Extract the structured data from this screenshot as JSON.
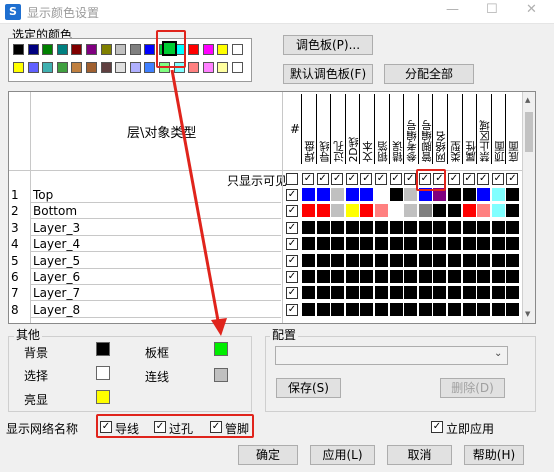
{
  "window": {
    "title": "显示颜色设置",
    "minimize": "—",
    "maximize": "☐",
    "close": "✕",
    "icon": "S"
  },
  "selected_color": {
    "label": "选定的颜色",
    "value": "#00cc33"
  },
  "palette": {
    "row1": [
      "#000000",
      "#000080",
      "#008000",
      "#008080",
      "#800000",
      "#800080",
      "#808000",
      "#c0c0c0",
      "#808080",
      "#0000ff",
      "#00cc33",
      "#00ffff",
      "#ff0000",
      "#ff00ff",
      "#ffff00",
      "#ffffff"
    ],
    "row2": [
      "#ffff00",
      "#6060ff",
      "#40b0b0",
      "#40a040",
      "#c08040",
      "#a06030",
      "#604040",
      "#e0e0e0",
      "#b0b0ff",
      "#4080ff",
      "#80ff80",
      "#80ffff",
      "#ff8080",
      "#ff80ff",
      "#ffffa0",
      "#ffffff"
    ]
  },
  "buttons": {
    "palette": "调色板(P)...",
    "default_palette": "默认调色板(F)",
    "assign_all": "分配全部",
    "save": "保存(S)",
    "delete": "删除(D)",
    "ok": "确定",
    "apply": "应用(L)",
    "cancel": "取消",
    "help": "帮助(H)"
  },
  "table": {
    "layer_header": "层\\对象类型",
    "hash_header": "#",
    "columns": [
      "焊盘",
      "导线",
      "过孔",
      "2D线",
      "文本",
      "铜箔",
      "错误",
      "参考编号",
      "管脚编号",
      "网络名",
      "类型",
      "属性",
      "禁止区域",
      "顶面",
      "底面"
    ],
    "visible_only_label": "只显示可见",
    "rows": [
      {
        "num": "1",
        "name": "Top"
      },
      {
        "num": "2",
        "name": "Bottom"
      },
      {
        "num": "3",
        "name": "Layer_3"
      },
      {
        "num": "4",
        "name": "Layer_4"
      },
      {
        "num": "5",
        "name": "Layer_5"
      },
      {
        "num": "6",
        "name": "Layer_6"
      },
      {
        "num": "7",
        "name": "Layer_7"
      },
      {
        "num": "8",
        "name": "Layer_8"
      }
    ],
    "cell_colors": [
      [
        "#0000ff",
        "#0000ff",
        "#c0c0c0",
        "#0000ff",
        "#0000ff",
        "#ffffff",
        "#000000",
        "#c0c0c0",
        "#0000ff",
        "#800080",
        "#000000",
        "#000000",
        "#0000ff",
        "#80ffff",
        "#000000"
      ],
      [
        "#ff0000",
        "#ff0000",
        "#c0c0c0",
        "#ffff00",
        "#ff0000",
        "#ff8080",
        "#ffffff",
        "#c0c0c0",
        "#808080",
        "#000000",
        "#000000",
        "#ff0000",
        "#ff8080",
        "#80ffff",
        "#000000"
      ],
      [
        "#000000",
        "#000000",
        "#000000",
        "#000000",
        "#000000",
        "#000000",
        "#000000",
        "#000000",
        "#000000",
        "#000000",
        "#000000",
        "#000000",
        "#000000",
        "#000000",
        "#000000"
      ],
      [
        "#000000",
        "#000000",
        "#000000",
        "#000000",
        "#000000",
        "#000000",
        "#000000",
        "#000000",
        "#000000",
        "#000000",
        "#000000",
        "#000000",
        "#000000",
        "#000000",
        "#000000"
      ],
      [
        "#000000",
        "#000000",
        "#000000",
        "#000000",
        "#000000",
        "#000000",
        "#000000",
        "#000000",
        "#000000",
        "#000000",
        "#000000",
        "#000000",
        "#000000",
        "#000000",
        "#000000"
      ],
      [
        "#000000",
        "#000000",
        "#000000",
        "#000000",
        "#000000",
        "#000000",
        "#000000",
        "#000000",
        "#000000",
        "#000000",
        "#000000",
        "#000000",
        "#000000",
        "#000000",
        "#000000"
      ],
      [
        "#000000",
        "#000000",
        "#000000",
        "#000000",
        "#000000",
        "#000000",
        "#000000",
        "#000000",
        "#000000",
        "#000000",
        "#000000",
        "#000000",
        "#000000",
        "#000000",
        "#000000"
      ],
      [
        "#000000",
        "#000000",
        "#000000",
        "#000000",
        "#000000",
        "#000000",
        "#000000",
        "#000000",
        "#000000",
        "#000000",
        "#000000",
        "#000000",
        "#000000",
        "#000000",
        "#000000"
      ]
    ]
  },
  "other": {
    "title": "其他",
    "items": [
      {
        "label": "背景",
        "color": "#000000"
      },
      {
        "label": "选择",
        "color": "#ffffff"
      },
      {
        "label": "亮显",
        "color": "#ffff00"
      },
      {
        "label": "板框",
        "color": "#00ee00"
      },
      {
        "label": "连线",
        "color": "#c0c0c0"
      }
    ]
  },
  "config": {
    "title": "配置",
    "value": ""
  },
  "net_names": {
    "label": "显示网络名称",
    "options": [
      {
        "label": "导线",
        "checked": true
      },
      {
        "label": "过孔",
        "checked": true
      },
      {
        "label": "管脚",
        "checked": true
      }
    ]
  },
  "apply_now": {
    "label": "立即应用",
    "checked": true
  },
  "accent": "#e0241c"
}
